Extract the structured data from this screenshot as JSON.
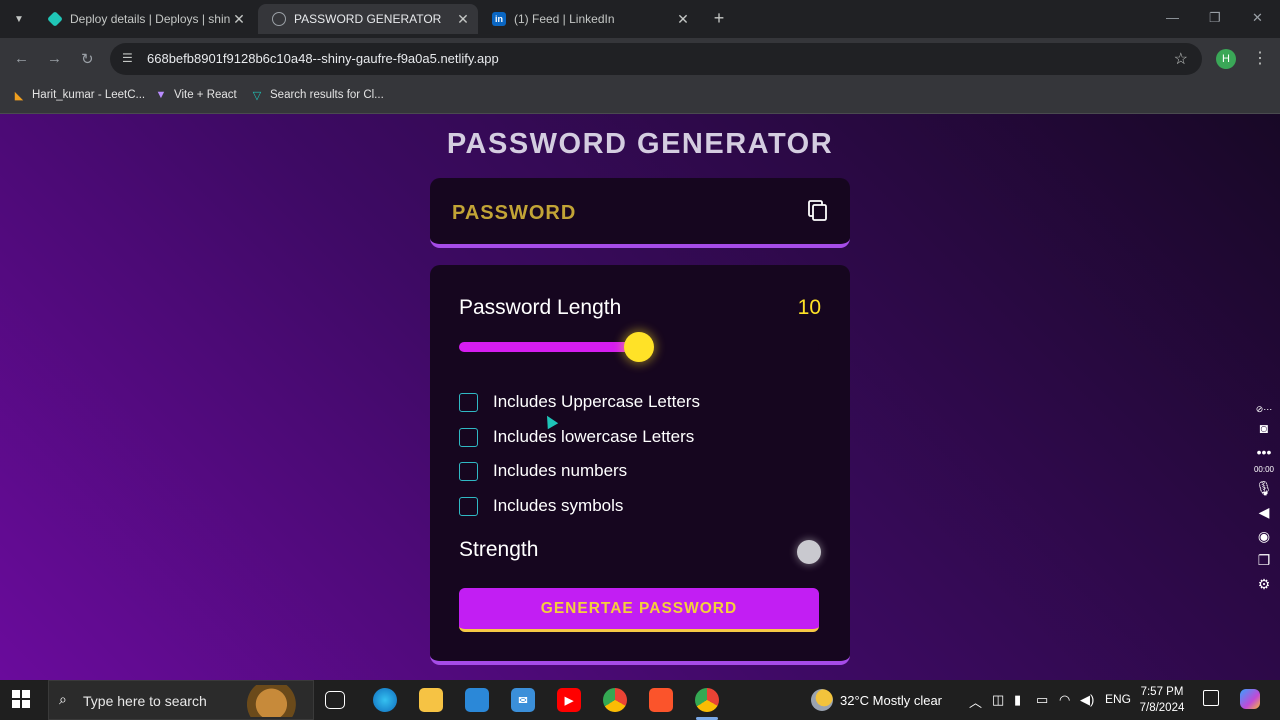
{
  "browser": {
    "tabs": [
      {
        "title": "Deploy details | Deploys | shiny",
        "favicon_color": "#20c6b7"
      },
      {
        "title": "PASSWORD GENERATOR",
        "favicon_color": "#9aa0a6"
      },
      {
        "title": "(1) Feed | LinkedIn",
        "favicon_color": "#0a66c2",
        "favicon_text": "in"
      }
    ],
    "url": "668befb8901f9128b6c10a48--shiny-gaufre-f9a0a5.netlify.app",
    "profile_initial": "H",
    "bookmarks": [
      {
        "label": "Harit_kumar - LeetC...",
        "icon": "leetcode-icon"
      },
      {
        "label": "Vite + React",
        "icon": "vite-icon"
      },
      {
        "label": "Search results for Cl...",
        "icon": "vuetify-icon"
      }
    ]
  },
  "app": {
    "title": "PASSWORD GENERATOR",
    "password_display": "PASSWORD",
    "length_label": "Password Length",
    "length_value": "10",
    "slider_fraction": 0.5,
    "options": [
      {
        "label": "Includes Uppercase Letters",
        "checked": false
      },
      {
        "label": "Includes lowercase Letters",
        "checked": false
      },
      {
        "label": "Includes numbers",
        "checked": false
      },
      {
        "label": "Includes symbols",
        "checked": false
      }
    ],
    "strength_label": "Strength",
    "generate_button": "GENERTAE PASSWORD",
    "colors": {
      "accent": "#ffe227",
      "slider_fill": "#d51df0",
      "button": "#c21ef3",
      "button_text": "#f5cf3b",
      "password_text": "#c2a436",
      "checkbox_border": "#30b9c4",
      "card_border": "#a64ce8",
      "strength_indicator": "#c9c9cf"
    }
  },
  "taskbar": {
    "search_placeholder": "Type here to search",
    "weather": "32°C  Mostly clear",
    "language": "ENG",
    "time": "7:57 PM",
    "date": "7/8/2024"
  }
}
